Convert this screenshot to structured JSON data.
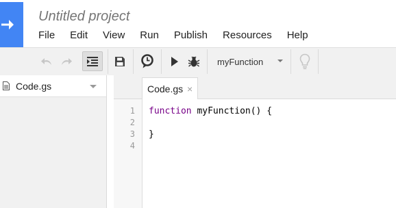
{
  "app": {
    "title": "Untitled project"
  },
  "menubar": {
    "items": [
      {
        "label": "File"
      },
      {
        "label": "Edit"
      },
      {
        "label": "View"
      },
      {
        "label": "Run"
      },
      {
        "label": "Publish"
      },
      {
        "label": "Resources"
      },
      {
        "label": "Help"
      }
    ]
  },
  "toolbar": {
    "function_select": {
      "selected": "myFunction"
    },
    "icons": [
      "undo-icon",
      "redo-icon",
      "indent-icon",
      "save-icon",
      "triggers-clock-icon",
      "run-play-icon",
      "debug-bug-icon",
      "lightbulb-icon"
    ]
  },
  "sidebar": {
    "files": [
      {
        "label": "Code.gs"
      }
    ]
  },
  "editor": {
    "tabs": [
      {
        "label": "Code.gs",
        "close": "×"
      }
    ],
    "line_numbers": [
      "1",
      "2",
      "3",
      "4"
    ],
    "lines": [
      {
        "keyword": "function",
        "rest": " myFunction() {"
      },
      {
        "keyword": "",
        "rest": ""
      },
      {
        "keyword": "",
        "rest": "}"
      },
      {
        "keyword": "",
        "rest": ""
      }
    ]
  },
  "colors": {
    "brand": "#4285f4",
    "toolbar_bg": "#f1f1f1",
    "keyword": "#770088"
  }
}
